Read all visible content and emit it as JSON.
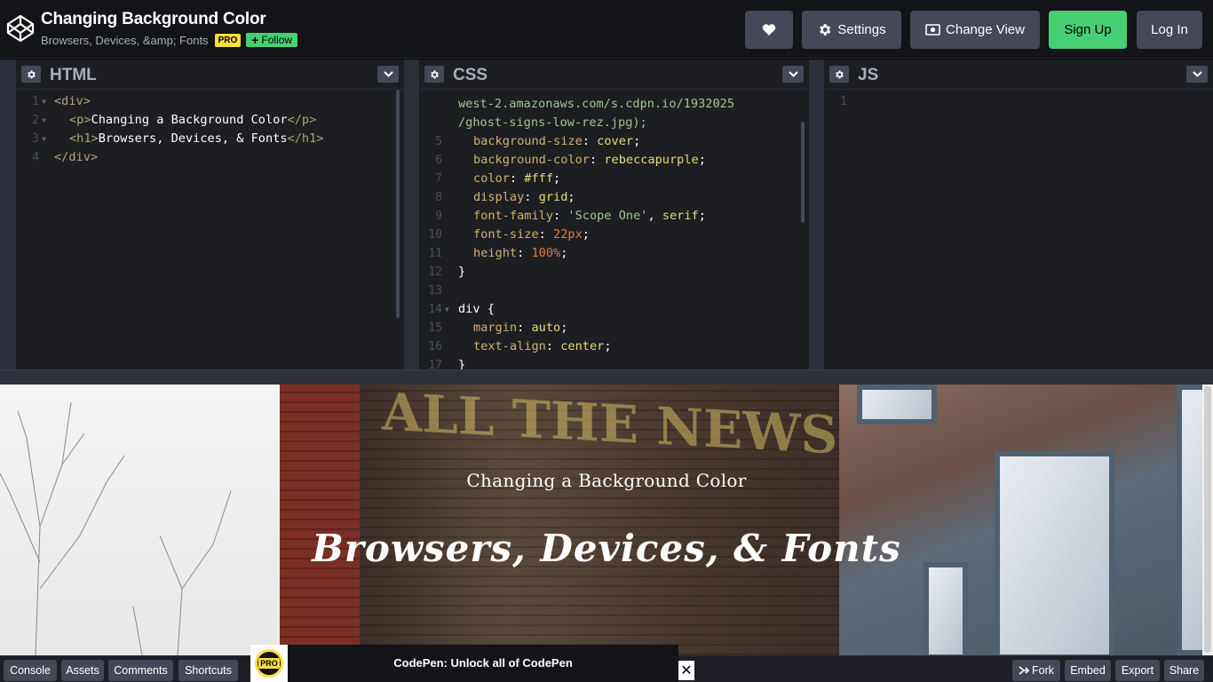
{
  "header": {
    "title": "Changing Background Color",
    "subtitle": "Browsers, Devices, &amp; Fonts",
    "pro_badge": "PRO",
    "follow_label": "Follow",
    "settings_label": "Settings",
    "change_view_label": "Change View",
    "signup_label": "Sign Up",
    "login_label": "Log In"
  },
  "panels": {
    "html_title": "HTML",
    "css_title": "CSS",
    "js_title": "JS"
  },
  "html_code": [
    {
      "n": "1",
      "parts": [
        [
          "tag",
          "<div>"
        ]
      ]
    },
    {
      "n": "2",
      "parts": [
        [
          "tag",
          "<p>"
        ],
        [
          "plain",
          "Changing a Background Color"
        ],
        [
          "tag",
          "</p>"
        ]
      ]
    },
    {
      "n": "3",
      "parts": [
        [
          "tag",
          "<h1>"
        ],
        [
          "plain",
          "Browsers, Devices, & Fonts"
        ],
        [
          "tag",
          "</h1>"
        ]
      ]
    },
    {
      "n": "4",
      "parts": [
        [
          "tag",
          "</div>"
        ]
      ]
    }
  ],
  "css_code": [
    {
      "n": "",
      "text": "west-2.amazonaws.com/s.cdpn.io/1932025"
    },
    {
      "n": "",
      "text": "/ghost-signs-low-rez.jpg);"
    },
    {
      "n": "5",
      "prop": "background-size",
      "val": "cover",
      "kind": "kw"
    },
    {
      "n": "6",
      "prop": "background-color",
      "val": "rebeccapurple",
      "kind": "kw"
    },
    {
      "n": "7",
      "prop": "color",
      "val": "#fff",
      "kind": "kw"
    },
    {
      "n": "8",
      "prop": "display",
      "val": "grid",
      "kind": "kw"
    },
    {
      "n": "9",
      "prop": "font-family",
      "val": "'Scope One', serif",
      "kind": "mixed"
    },
    {
      "n": "10",
      "prop": "font-size",
      "val": "22px",
      "kind": "num"
    },
    {
      "n": "11",
      "prop": "height",
      "val": "100%",
      "kind": "num"
    },
    {
      "n": "12",
      "text": "}"
    },
    {
      "n": "13",
      "text": ""
    },
    {
      "n": "14",
      "text": "div {"
    },
    {
      "n": "15",
      "prop": "margin",
      "val": "auto",
      "kind": "kw"
    },
    {
      "n": "16",
      "prop": "text-align",
      "val": "center",
      "kind": "kw"
    },
    {
      "n": "17",
      "text": "}"
    }
  ],
  "js_code": [
    {
      "n": "1",
      "text": ""
    }
  ],
  "preview": {
    "subtitle": "Changing a Background Color",
    "heading": "Browsers, Devices, & Fonts",
    "ghost_sign": "ALL THE NEWS"
  },
  "footer": {
    "console": "Console",
    "assets": "Assets",
    "comments": "Comments",
    "shortcuts": "Shortcuts",
    "fork": "Fork",
    "embed": "Embed",
    "export": "Export",
    "share": "Share"
  },
  "promo": {
    "badge": "PRO",
    "text": "CodePen: Unlock all of CodePen",
    "close": "✕"
  },
  "colors": {
    "accent_green": "#47cf73",
    "pro_yellow": "#ffdd40",
    "button_gray": "#444857",
    "header_bg": "#131417"
  },
  "icons": [
    "codepen-logo-icon",
    "heart-icon",
    "gear-icon",
    "eye-icon",
    "chevron-down-icon",
    "plus-icon",
    "fork-icon",
    "close-icon"
  ]
}
